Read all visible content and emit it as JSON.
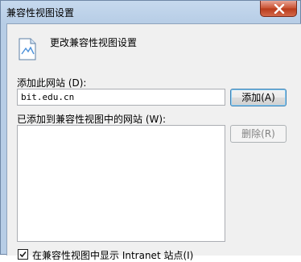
{
  "window": {
    "title": "兼容性视图设置"
  },
  "header": {
    "text": "更改兼容性视图设置"
  },
  "add_section": {
    "label": "添加此网站 (D):",
    "input_value": "bit.edu.cn",
    "add_button": "添加(A)"
  },
  "list_section": {
    "label": "已添加到兼容性视图中的网站 (W):",
    "remove_button": "删除(R)",
    "items": []
  },
  "options": {
    "intranet_checkbox_label": "在兼容性视图中显示 Intranet 站点(I)",
    "intranet_checked": true
  }
}
